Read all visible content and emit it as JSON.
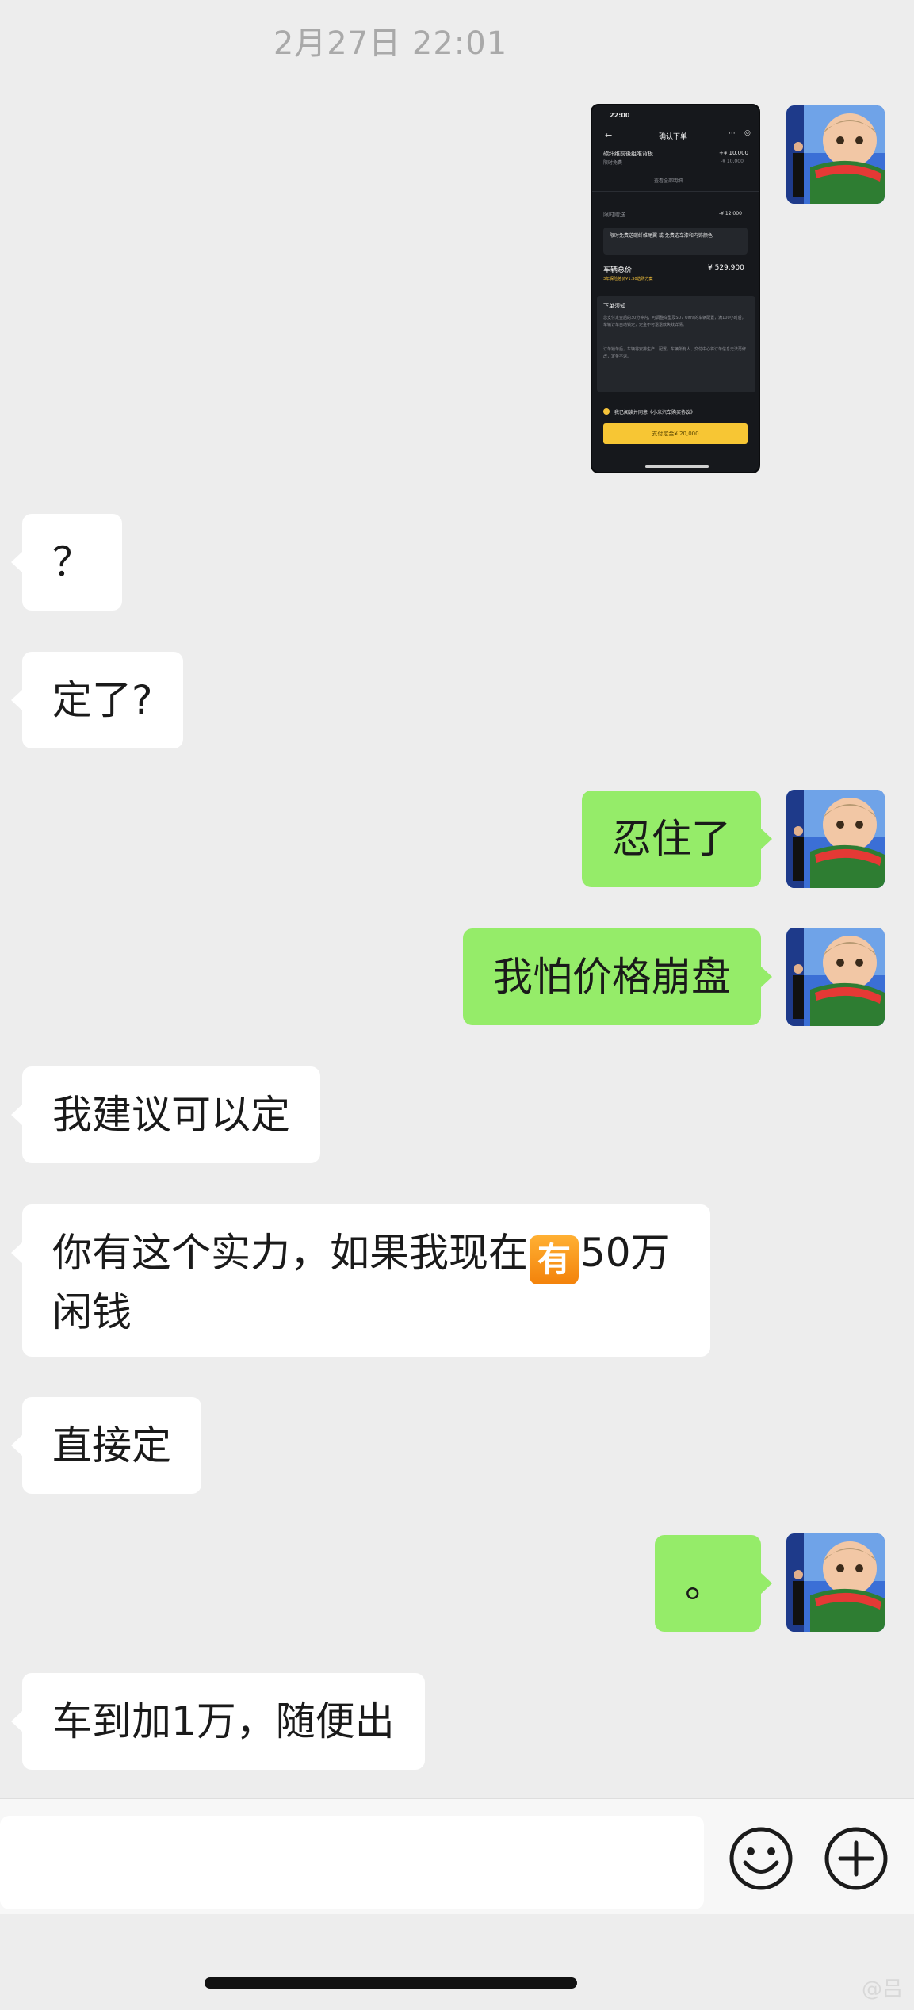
{
  "timestamp": "2月27日 22:01",
  "avatar_icon": "watermelon-kid-avatar",
  "screenshot": {
    "status_time": "22:00",
    "title": "确认下单",
    "line1_label": "碳纤维前後组唯背板",
    "line1_value": "+¥ 10,000",
    "line2_label": "限时免费",
    "line2_value": "-¥ 10,000",
    "view_all": "查看全部明细",
    "discount_label": "限时赠送",
    "discount_value": "-¥ 12,000",
    "promo_text": "限时免费送碳纤维尾翼 或 免费选车漆和内饰颜色",
    "total_label": "车辆总价",
    "total_value": "¥ 529,900",
    "total_note": "3年保险总价¥1.30选购方案",
    "notice_title": "下单须知",
    "notice_text": "您支付定金后的30分钟内，可调整车型及SU7 Ultra的车辆配置，满100小时后，车辆订单自动锁定，定金不可退退款失效详情。",
    "notice_text2": "订单锁单后，车辆将安排生产、配置，车辆所有人、交付中心将订单信息无法再修改，定金不退。",
    "agree_text": "我已阅读并同意《小米汽车购买协议》",
    "pay_button": "支付定金¥ 20,000"
  },
  "messages": [
    {
      "side": "in",
      "text": "？"
    },
    {
      "side": "in",
      "text": "定了?"
    },
    {
      "side": "out",
      "text": "忍住了"
    },
    {
      "side": "out",
      "text": "我怕价格崩盘"
    },
    {
      "side": "in",
      "text": "我建议可以定"
    },
    {
      "side": "in",
      "text_before": "你有这个实力，如果我现在",
      "highlight": "有",
      "text_after": "50万闲钱"
    },
    {
      "side": "in",
      "text": "直接定"
    },
    {
      "side": "out",
      "text": "。"
    },
    {
      "side": "in",
      "text": "车到加1万，随便出"
    }
  ],
  "input": {
    "value": "",
    "emoji_icon": "emoji-icon",
    "plus_icon": "plus-icon"
  },
  "watermark": "@吕"
}
